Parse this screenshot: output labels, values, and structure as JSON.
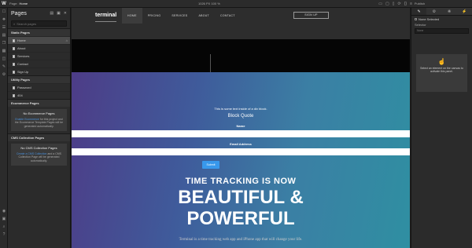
{
  "topbar": {
    "logo": "W",
    "page_label": "Page:",
    "page_name": "Home",
    "dims": "1026 PX  100 %",
    "publish": "Publish",
    "icons": [
      "▭",
      "▢",
      "▯",
      "◍",
      "⟳",
      "{}",
      "≡"
    ]
  },
  "left_rail": {
    "icons": [
      "☐",
      "❖",
      "☰",
      "▤",
      "❐",
      "▦",
      "◫",
      "✎",
      "⚙",
      "◉",
      "▣",
      "⌕",
      "?"
    ]
  },
  "pages_panel": {
    "title": "Pages",
    "search_placeholder": "Search pages",
    "static_section": "Static Pages",
    "static_pages": [
      "Home",
      "About",
      "Services",
      "Contact",
      "Sign Up"
    ],
    "utility_section": "Utility Pages",
    "utility_pages": [
      "Password",
      "404"
    ],
    "ecommerce_section": "Ecommerce Pages",
    "ecommerce_empty_title": "No Ecommerce Pages",
    "ecommerce_empty_link": "Enable Ecommerce",
    "ecommerce_empty_text": "for this project and the Ecommerce Template Pages will be generated automatically.",
    "cms_section": "CMS Collection Pages",
    "cms_empty_title": "No CMS Collection Pages",
    "cms_empty_link": "Create a CMS Collection",
    "cms_empty_text": "and a CMS Collection Page will be generated automatically."
  },
  "site": {
    "brand": "terminal",
    "nav": [
      "HOME",
      "PRICING",
      "SERVICES",
      "ABOUT",
      "CONTACT"
    ],
    "signup": "SIGN UP",
    "text_block": "This is some text inside of a div block.",
    "block_quote": "Block Quote",
    "name_label": "Name",
    "email_label": "Email Address",
    "submit": "Submit",
    "subheading": "TIME TRACKING IS NOW",
    "heading_line1": "BEAUTIFUL &",
    "heading_line2": "POWERFUL",
    "paragraph": "Terminal is a time tracking web app and iPhone app that will change your life."
  },
  "right_panel": {
    "tabs": [
      "✎",
      "⚙",
      "❋",
      "⚡"
    ],
    "none_selected": "None Selected",
    "selector_label": "Selector",
    "selector_value": "None",
    "hint": "Select an element on the canvas to activate this panel."
  }
}
